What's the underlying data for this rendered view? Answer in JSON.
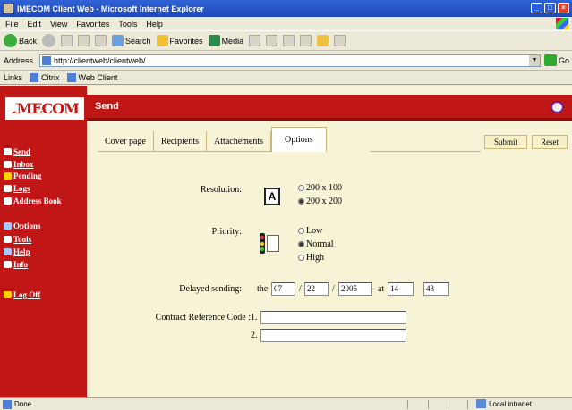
{
  "window": {
    "title": "IMECOM Client Web - Microsoft Internet Explorer"
  },
  "menu": {
    "items": [
      "File",
      "Edit",
      "View",
      "Favorites",
      "Tools",
      "Help"
    ]
  },
  "toolbar": {
    "back_label": "Back",
    "search_label": "Search",
    "favorites_label": "Favorites",
    "media_label": "Media"
  },
  "address": {
    "label": "Address",
    "value": "http://clientweb/clientweb/",
    "go_label": "Go"
  },
  "links": {
    "label": "Links",
    "items": [
      "Citrix",
      "Web Client"
    ]
  },
  "sidebar": {
    "logo": "IMECOM",
    "nav": [
      {
        "label": "Send"
      },
      {
        "label": "Inbox"
      },
      {
        "label": "Pending"
      },
      {
        "label": "Logs"
      },
      {
        "label": "Address Book"
      },
      {
        "label": "Options"
      },
      {
        "label": "Tools"
      },
      {
        "label": "Help"
      },
      {
        "label": "Info"
      },
      {
        "label": "Log Off"
      }
    ]
  },
  "header": {
    "title": "Send"
  },
  "tabs": [
    "Cover page",
    "Recipients",
    "Attachements",
    "Options"
  ],
  "actions": {
    "submit": "Submit",
    "reset": "Reset"
  },
  "form": {
    "resolution": {
      "label": "Resolution:",
      "options": [
        "200 x 100",
        "200 x 200"
      ],
      "selected": "200 x 200"
    },
    "priority": {
      "label": "Priority:",
      "options": [
        "Low",
        "Normal",
        "High"
      ],
      "selected": "Normal"
    },
    "delayed": {
      "label": "Delayed sending:",
      "the": "the",
      "month": "07",
      "day": "22",
      "year": "2005",
      "at": "at",
      "hour": "14",
      "minute": "43",
      "sep": "/"
    },
    "contract": {
      "label": "Contract Reference Code :",
      "line1": "1.",
      "line2": "2.",
      "value1": "",
      "value2": ""
    }
  },
  "status": {
    "text": "Done",
    "zone": "Local intranet"
  }
}
